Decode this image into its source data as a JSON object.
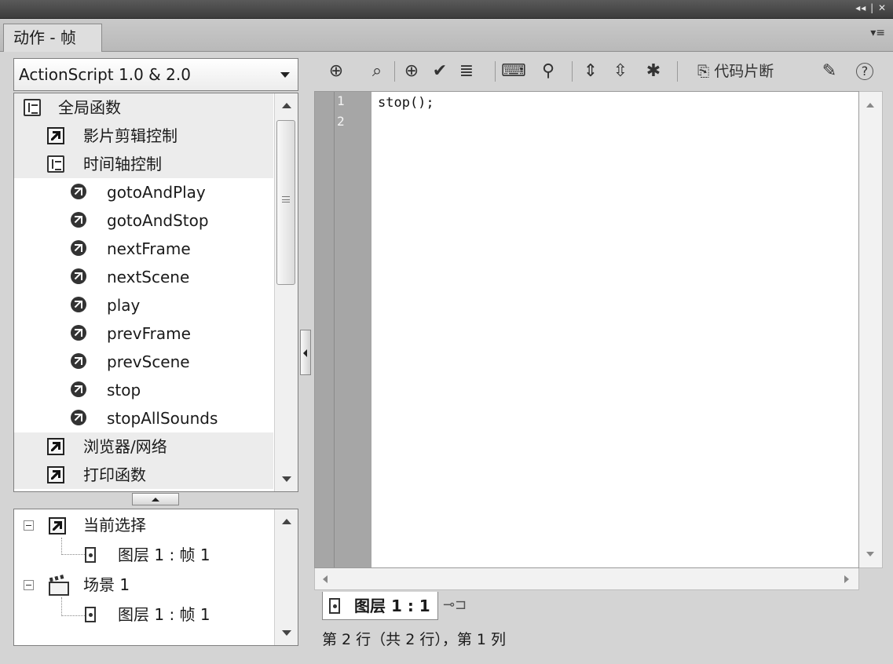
{
  "window": {
    "controls": "◂◂ | ✕"
  },
  "panel": {
    "tab_label": "动作 - 帧",
    "menu_icon": "panel-menu-icon"
  },
  "language_selector": {
    "value": "ActionScript 1.0 & 2.0"
  },
  "toolbox": {
    "items": [
      {
        "label": "全局函数",
        "icon": "book-open-icon"
      },
      {
        "label": "影片剪辑控制",
        "icon": "function-category-icon"
      },
      {
        "label": "时间轴控制",
        "icon": "book-open-icon"
      },
      {
        "label": "gotoAndPlay",
        "icon": "action-item-icon"
      },
      {
        "label": "gotoAndStop",
        "icon": "action-item-icon"
      },
      {
        "label": "nextFrame",
        "icon": "action-item-icon"
      },
      {
        "label": "nextScene",
        "icon": "action-item-icon"
      },
      {
        "label": "play",
        "icon": "action-item-icon"
      },
      {
        "label": "prevFrame",
        "icon": "action-item-icon"
      },
      {
        "label": "prevScene",
        "icon": "action-item-icon"
      },
      {
        "label": "stop",
        "icon": "action-item-icon"
      },
      {
        "label": "stopAllSounds",
        "icon": "action-item-icon"
      },
      {
        "label": "浏览器/网络",
        "icon": "function-category-icon"
      },
      {
        "label": "打印函数",
        "icon": "function-category-icon"
      }
    ]
  },
  "navigator": {
    "items": [
      {
        "label": "当前选择",
        "icon": "selection-icon"
      },
      {
        "label": "图层 1 : 帧 1",
        "icon": "frame-icon"
      },
      {
        "label": "场景 1",
        "icon": "scene-clapper-icon"
      },
      {
        "label": "图层 1 : 帧 1",
        "icon": "frame-icon"
      }
    ]
  },
  "script_toolbar": {
    "buttons": [
      {
        "name": "add-item-button",
        "glyph": "⊕"
      },
      {
        "name": "find-button",
        "glyph": "⌕"
      },
      {
        "name": "insert-target-path-button",
        "glyph": "⊕"
      },
      {
        "name": "check-syntax-button",
        "glyph": "✔"
      },
      {
        "name": "auto-format-button",
        "glyph": "≣"
      },
      {
        "name": "show-code-hint-button",
        "glyph": "⌨"
      },
      {
        "name": "debug-options-button",
        "glyph": "⚲"
      },
      {
        "name": "collapse-between-braces-button",
        "glyph": "⇕"
      },
      {
        "name": "collapse-selection-button",
        "glyph": "⇳"
      },
      {
        "name": "expand-all-button",
        "glyph": "✱"
      }
    ],
    "snippets_label": "代码片断",
    "help": "?"
  },
  "editor": {
    "line_numbers": [
      "1",
      "2"
    ],
    "lines": [
      "stop();"
    ]
  },
  "script_tab": {
    "label": "图层 1 : 1"
  },
  "status": {
    "text": "第 2 行（共 2 行），第 1 列"
  },
  "colors": {
    "gutter": "#a6a6a6",
    "chrome": "#d4d4d4",
    "titlebar": "#3c3c3c"
  }
}
